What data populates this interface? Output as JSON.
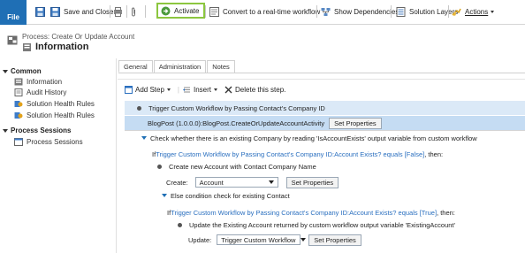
{
  "ribbon": {
    "file_label": "File",
    "save_close_label": "Save and Close",
    "activate_label": "Activate",
    "convert_label": "Convert to a real-time workflow",
    "dependencies_label": "Show Dependencies",
    "solution_layers_label": "Solution Layers",
    "actions_label": "Actions"
  },
  "header": {
    "process_title": "Process: Create Or Update Account",
    "form_title": "Information"
  },
  "nav": {
    "common_label": "Common",
    "common_items": [
      "Information",
      "Audit History",
      "Solution Health Rules",
      "Solution Health Rules"
    ],
    "process_sessions_label": "Process Sessions",
    "process_items": [
      "Process Sessions"
    ]
  },
  "tabs": [
    "General",
    "Administration",
    "Notes"
  ],
  "step_toolbar": {
    "add_step": "Add Step",
    "insert": "Insert",
    "delete": "Delete this step."
  },
  "steps": {
    "s1_title": "Trigger Custom Workflow by Passing Contact's Company ID",
    "s1_activity": "BlogPost (1.0.0.0):BlogPost.CreateOrUpdateAccountActivity",
    "set_properties": "Set Properties",
    "s2_title": "Check whether there is an existing Company by reading 'IsAccountExists' output variable from custom workflow",
    "if1_prefix": "If ",
    "if1_cond": "Trigger Custom Workflow by Passing Contact's Company ID:Account Exists? equals [False]",
    "if1_suffix": ", then:",
    "s3_title": "Create new Account with Contact Company Name",
    "create_label": "Create:",
    "create_value": "Account",
    "else_title": "Else condition check for existing Contact",
    "if2_prefix": "If ",
    "if2_cond": "Trigger Custom Workflow by Passing Contact's Company ID:Account Exists? equals [True]",
    "if2_suffix": ", then:",
    "s4_title": "Update the Existing Account returned by custom workflow output variable 'ExistingAccount'",
    "update_label": "Update:",
    "update_value": "Trigger Custom Workflow"
  },
  "colors": {
    "file_blue": "#1f6fb5",
    "activate_highlight": "#8cc63f",
    "link": "#2a6fbf",
    "row_blue": "#dbe9f7"
  }
}
